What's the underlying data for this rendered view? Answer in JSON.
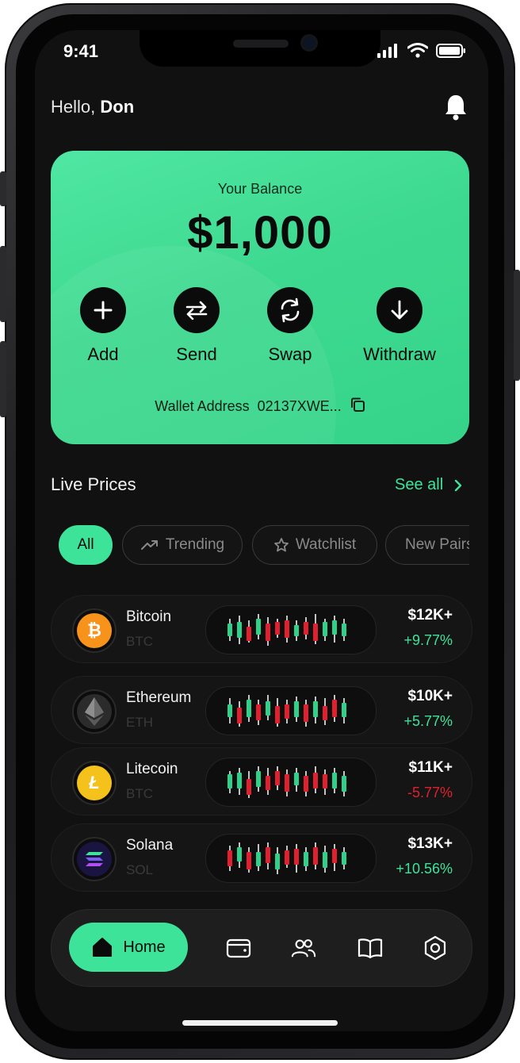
{
  "status_bar": {
    "time": "9:41"
  },
  "header": {
    "greeting_prefix": "Hello,",
    "user_name": "Don"
  },
  "balance_card": {
    "label": "Your Balance",
    "amount": "$1,000",
    "actions": [
      {
        "label": "Add",
        "icon": "plus-icon"
      },
      {
        "label": "Send",
        "icon": "transfer-arrows-icon"
      },
      {
        "label": "Swap",
        "icon": "swap-cycle-icon"
      },
      {
        "label": "Withdraw",
        "icon": "arrow-down-icon"
      }
    ],
    "wallet_label": "Wallet Address",
    "wallet_address": "02137XWE..."
  },
  "live_prices": {
    "title": "Live Prices",
    "see_all": "See all",
    "filters": [
      {
        "label": "All",
        "active": true
      },
      {
        "label": "Trending",
        "icon": "trending-up-icon"
      },
      {
        "label": "Watchlist",
        "icon": "star-icon"
      },
      {
        "label": "New Pairs"
      }
    ],
    "coins": [
      {
        "name": "Bitcoin",
        "symbol": "BTC",
        "price": "$12K+",
        "change": "+9.77%",
        "trend": "up",
        "logo_color": "#f7931a",
        "logo_glyph": "₿"
      },
      {
        "name": "Ethereum",
        "symbol": "ETH",
        "price": "$10K+",
        "change": "+5.77%",
        "trend": "up",
        "logo_color": "#2b2b2b",
        "logo_glyph": "◆"
      },
      {
        "name": "Litecoin",
        "symbol": "BTC",
        "price": "$11K+",
        "change": "-5.77%",
        "trend": "down",
        "logo_color": "#f4c21a",
        "logo_glyph": "Ł"
      },
      {
        "name": "Solana",
        "symbol": "SOL",
        "price": "$13K+",
        "change": "+10.56%",
        "trend": "up",
        "logo_color": "#1a1440",
        "logo_glyph": "≡"
      }
    ]
  },
  "bottom_nav": {
    "items": [
      {
        "label": "Home",
        "icon": "home-icon",
        "active": true
      },
      {
        "icon": "wallet-icon"
      },
      {
        "icon": "users-icon"
      },
      {
        "icon": "book-icon"
      },
      {
        "icon": "settings-hexagon-icon"
      }
    ]
  },
  "colors": {
    "accent": "#3ee39a",
    "up": "#3ee39a",
    "down": "#e0202f"
  }
}
